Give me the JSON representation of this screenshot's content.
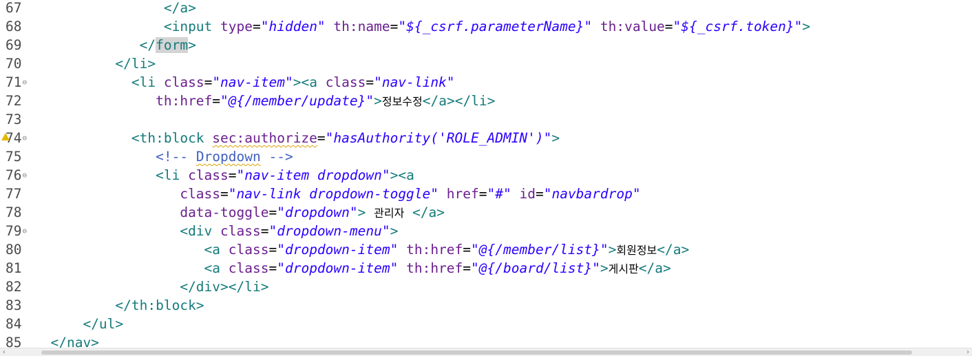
{
  "lines": [
    {
      "n": "67",
      "fold": false,
      "warn": false,
      "tokens": [
        [
          "t",
          "                "
        ],
        [
          "tag",
          "</a>"
        ]
      ]
    },
    {
      "n": "68",
      "fold": false,
      "warn": false,
      "tokens": [
        [
          "t",
          "                "
        ],
        [
          "tag",
          "<input "
        ],
        [
          "attr",
          "type"
        ],
        [
          "t",
          "="
        ],
        [
          "str",
          "\"hidden\""
        ],
        [
          "t",
          " "
        ],
        [
          "attr",
          "th:name"
        ],
        [
          "t",
          "="
        ],
        [
          "str",
          "\"${_csrf.parameterName}\""
        ],
        [
          "t",
          " "
        ],
        [
          "attr",
          "th:value"
        ],
        [
          "t",
          "="
        ],
        [
          "str",
          "\"${_csrf.token}\""
        ],
        [
          "tag",
          ">"
        ]
      ]
    },
    {
      "n": "69",
      "fold": false,
      "warn": false,
      "tokens": [
        [
          "t",
          "             "
        ],
        [
          "tag",
          "</"
        ],
        [
          "hl",
          "form"
        ],
        [
          "tag",
          ">"
        ]
      ]
    },
    {
      "n": "70",
      "fold": false,
      "warn": false,
      "tokens": [
        [
          "t",
          "          "
        ],
        [
          "tag",
          "</li>"
        ]
      ]
    },
    {
      "n": "71",
      "fold": true,
      "warn": false,
      "tokens": [
        [
          "t",
          "            "
        ],
        [
          "tag",
          "<li "
        ],
        [
          "attr",
          "class"
        ],
        [
          "t",
          "="
        ],
        [
          "str",
          "\"nav-item\""
        ],
        [
          "tag",
          "><a "
        ],
        [
          "attr",
          "class"
        ],
        [
          "t",
          "="
        ],
        [
          "str",
          "\"nav-link\""
        ]
      ]
    },
    {
      "n": "72",
      "fold": false,
      "warn": false,
      "tokens": [
        [
          "t",
          "               "
        ],
        [
          "attr",
          "th:href"
        ],
        [
          "t",
          "="
        ],
        [
          "str",
          "\"@{/member/update}\""
        ],
        [
          "tag",
          ">"
        ],
        [
          "kor",
          "정보수정"
        ],
        [
          "tag",
          "</a></li>"
        ]
      ]
    },
    {
      "n": "73",
      "fold": false,
      "warn": false,
      "tokens": []
    },
    {
      "n": "74",
      "fold": true,
      "warn": true,
      "tokens": [
        [
          "t",
          "            "
        ],
        [
          "tag",
          "<th:block "
        ],
        [
          "squig",
          "sec:authorize"
        ],
        [
          "t",
          "="
        ],
        [
          "str",
          "\"hasAuthority('ROLE_ADMIN')\""
        ],
        [
          "tag",
          ">"
        ]
      ]
    },
    {
      "n": "75",
      "fold": false,
      "warn": false,
      "tokens": [
        [
          "t",
          "               "
        ],
        [
          "cmt",
          "<!-- "
        ],
        [
          "cmtsq",
          "Dropdown"
        ],
        [
          "cmt",
          " -->"
        ]
      ]
    },
    {
      "n": "76",
      "fold": true,
      "warn": false,
      "tokens": [
        [
          "t",
          "               "
        ],
        [
          "tag",
          "<li "
        ],
        [
          "attr",
          "class"
        ],
        [
          "t",
          "="
        ],
        [
          "str",
          "\"nav-item dropdown\""
        ],
        [
          "tag",
          "><a"
        ]
      ]
    },
    {
      "n": "77",
      "fold": false,
      "warn": false,
      "tokens": [
        [
          "t",
          "                  "
        ],
        [
          "attr",
          "class"
        ],
        [
          "t",
          "="
        ],
        [
          "str",
          "\"nav-link dropdown-toggle\""
        ],
        [
          "t",
          " "
        ],
        [
          "attr",
          "href"
        ],
        [
          "t",
          "="
        ],
        [
          "str",
          "\"#\""
        ],
        [
          "t",
          " "
        ],
        [
          "attr",
          "id"
        ],
        [
          "t",
          "="
        ],
        [
          "str",
          "\"navbardrop\""
        ]
      ]
    },
    {
      "n": "78",
      "fold": false,
      "warn": false,
      "tokens": [
        [
          "t",
          "                  "
        ],
        [
          "attr",
          "data-toggle"
        ],
        [
          "t",
          "="
        ],
        [
          "str",
          "\"dropdown\""
        ],
        [
          "tag",
          ">"
        ],
        [
          "t",
          " "
        ],
        [
          "kor",
          "관리자"
        ],
        [
          "t",
          " "
        ],
        [
          "tag",
          "</a>"
        ]
      ]
    },
    {
      "n": "79",
      "fold": true,
      "warn": false,
      "tokens": [
        [
          "t",
          "                  "
        ],
        [
          "tag",
          "<div "
        ],
        [
          "attr",
          "class"
        ],
        [
          "t",
          "="
        ],
        [
          "str",
          "\"dropdown-menu\""
        ],
        [
          "tag",
          ">"
        ]
      ]
    },
    {
      "n": "80",
      "fold": false,
      "warn": false,
      "tokens": [
        [
          "t",
          "                     "
        ],
        [
          "tag",
          "<a "
        ],
        [
          "attr",
          "class"
        ],
        [
          "t",
          "="
        ],
        [
          "str",
          "\"dropdown-item\""
        ],
        [
          "t",
          " "
        ],
        [
          "attr",
          "th:href"
        ],
        [
          "t",
          "="
        ],
        [
          "str",
          "\"@{/member/list}\""
        ],
        [
          "tag",
          ">"
        ],
        [
          "kor",
          "회원정보"
        ],
        [
          "tag",
          "</a>"
        ]
      ]
    },
    {
      "n": "81",
      "fold": false,
      "warn": false,
      "tokens": [
        [
          "t",
          "                     "
        ],
        [
          "tag",
          "<a "
        ],
        [
          "attr",
          "class"
        ],
        [
          "t",
          "="
        ],
        [
          "str",
          "\"dropdown-item\""
        ],
        [
          "t",
          " "
        ],
        [
          "attr",
          "th:href"
        ],
        [
          "t",
          "="
        ],
        [
          "str",
          "\"@{/board/list}\""
        ],
        [
          "tag",
          ">"
        ],
        [
          "kor",
          "게시판"
        ],
        [
          "tag",
          "</a>"
        ]
      ]
    },
    {
      "n": "82",
      "fold": false,
      "warn": false,
      "tokens": [
        [
          "t",
          "                  "
        ],
        [
          "tag",
          "</div></li>"
        ]
      ]
    },
    {
      "n": "83",
      "fold": false,
      "warn": false,
      "tokens": [
        [
          "t",
          "          "
        ],
        [
          "tag",
          "</th:block>"
        ]
      ]
    },
    {
      "n": "84",
      "fold": false,
      "warn": false,
      "tokens": [
        [
          "t",
          "      "
        ],
        [
          "tag",
          "</ul>"
        ]
      ]
    },
    {
      "n": "85",
      "fold": false,
      "warn": false,
      "tokens": [
        [
          "t",
          "  "
        ],
        [
          "tag",
          "</nav>"
        ]
      ]
    }
  ],
  "fold_glyph": "⊖"
}
